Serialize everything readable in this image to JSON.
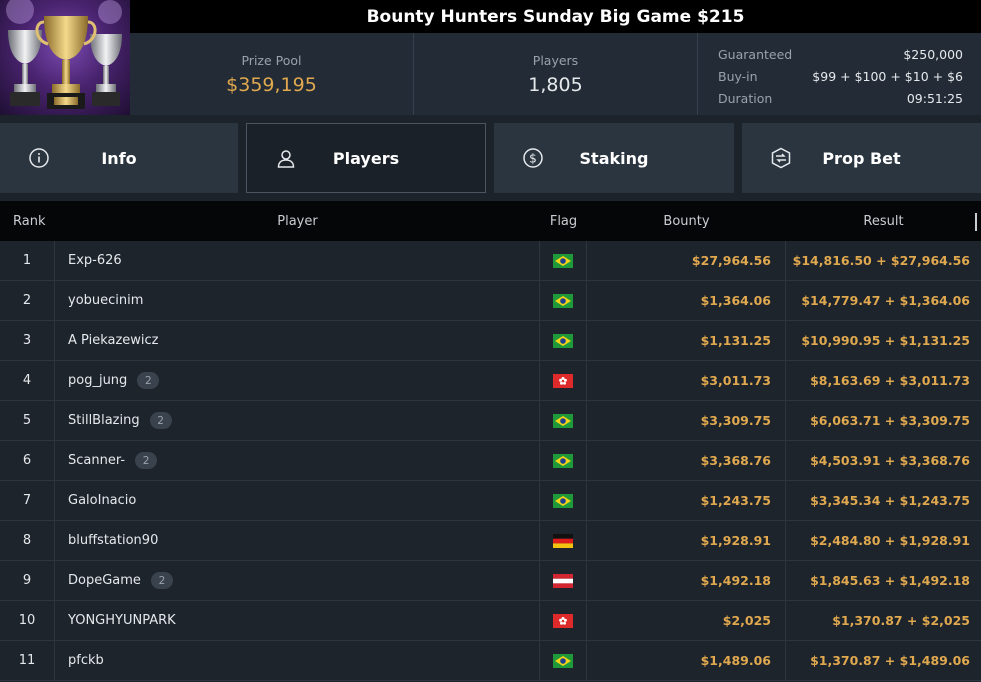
{
  "tournament": {
    "title": "Bounty Hunters Sunday Big Game $215"
  },
  "stats": {
    "prize_pool_label": "Prize Pool",
    "prize_pool_value": "$359,195",
    "players_label": "Players",
    "players_value": "1,805",
    "guaranteed_label": "Guaranteed",
    "guaranteed_value": "$250,000",
    "buyin_label": "Buy-in",
    "buyin_value": "$99 + $100 + $10 + $6",
    "duration_label": "Duration",
    "duration_value": "09:51:25"
  },
  "tabs": [
    {
      "label": "Info",
      "icon": "info-icon",
      "active": false
    },
    {
      "label": "Players",
      "icon": "user-icon",
      "active": true
    },
    {
      "label": "Staking",
      "icon": "dollar-circle-icon",
      "active": false
    },
    {
      "label": "Prop Bet",
      "icon": "prop-bet-icon",
      "active": false
    }
  ],
  "table": {
    "headers": {
      "rank": "Rank",
      "player": "Player",
      "flag": "Flag",
      "bounty": "Bounty",
      "result": "Result"
    },
    "rows": [
      {
        "rank": "1",
        "player": "Exp-626",
        "badge": "",
        "flag": "brazil",
        "bounty": "$27,964.56",
        "result": "$14,816.50 + $27,964.56"
      },
      {
        "rank": "2",
        "player": "yobuecinim",
        "badge": "",
        "flag": "brazil",
        "bounty": "$1,364.06",
        "result": "$14,779.47 + $1,364.06"
      },
      {
        "rank": "3",
        "player": "A Piekazewicz",
        "badge": "",
        "flag": "brazil",
        "bounty": "$1,131.25",
        "result": "$10,990.95 + $1,131.25"
      },
      {
        "rank": "4",
        "player": "pog_jung",
        "badge": "2",
        "flag": "hong-kong",
        "bounty": "$3,011.73",
        "result": "$8,163.69 + $3,011.73"
      },
      {
        "rank": "5",
        "player": "StillBlazing",
        "badge": "2",
        "flag": "brazil",
        "bounty": "$3,309.75",
        "result": "$6,063.71 + $3,309.75"
      },
      {
        "rank": "6",
        "player": "Scanner-",
        "badge": "2",
        "flag": "brazil",
        "bounty": "$3,368.76",
        "result": "$4,503.91 + $3,368.76"
      },
      {
        "rank": "7",
        "player": "GaloInacio",
        "badge": "",
        "flag": "brazil",
        "bounty": "$1,243.75",
        "result": "$3,345.34 + $1,243.75"
      },
      {
        "rank": "8",
        "player": "bluffstation90",
        "badge": "",
        "flag": "germany",
        "bounty": "$1,928.91",
        "result": "$2,484.80 + $1,928.91"
      },
      {
        "rank": "9",
        "player": "DopeGame",
        "badge": "2",
        "flag": "austria",
        "bounty": "$1,492.18",
        "result": "$1,845.63 + $1,492.18"
      },
      {
        "rank": "10",
        "player": "YONGHYUNPARK",
        "badge": "",
        "flag": "hong-kong",
        "bounty": "$2,025",
        "result": "$1,370.87 + $2,025"
      },
      {
        "rank": "11",
        "player": "pfckb",
        "badge": "",
        "flag": "brazil",
        "bounty": "$1,489.06",
        "result": "$1,370.87 + $1,489.06"
      }
    ]
  },
  "colors": {
    "accent_gold": "#e0a84f",
    "background": "#1c232b",
    "header_black": "#000000"
  }
}
